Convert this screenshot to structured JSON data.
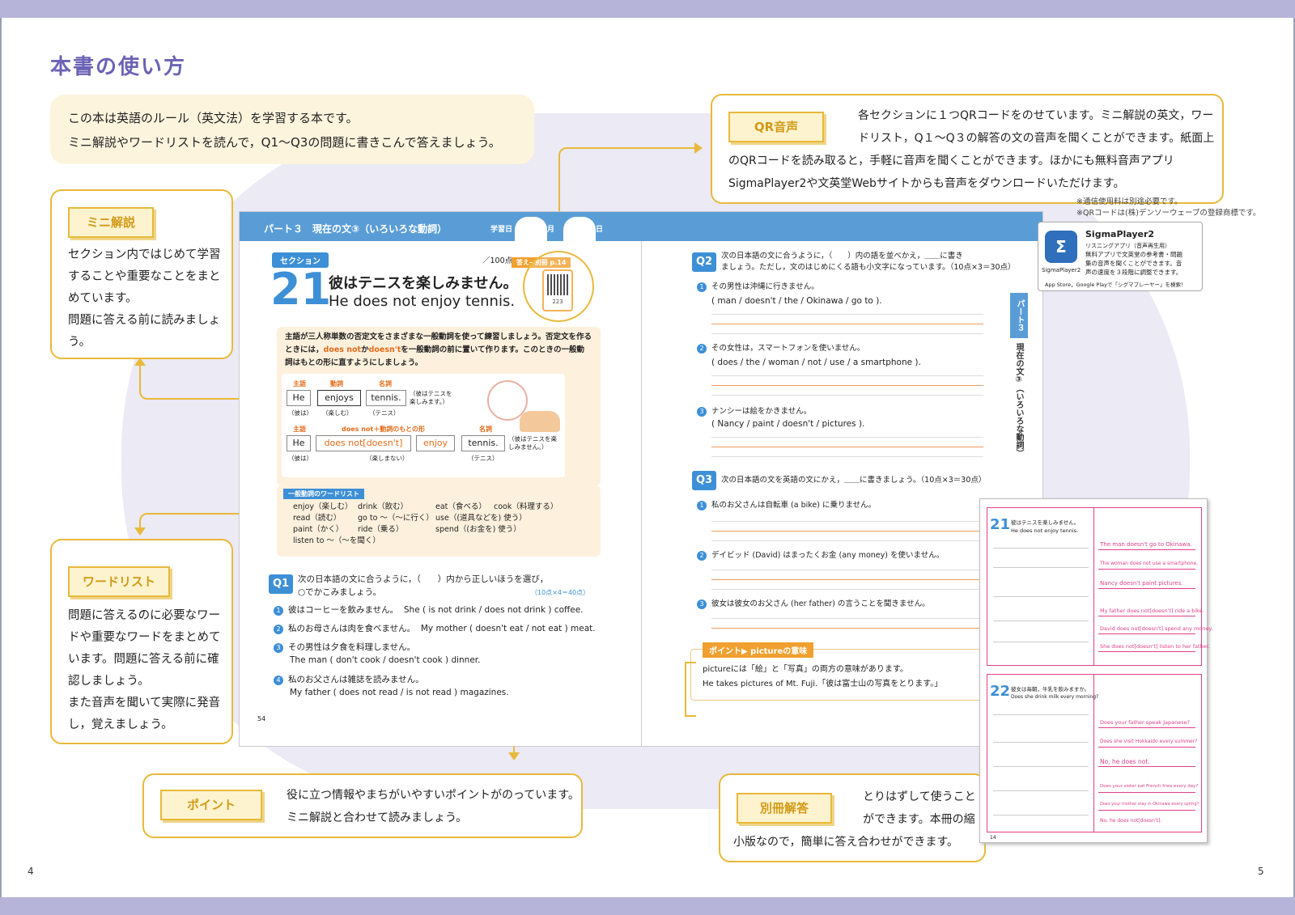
{
  "page_title": "本書の使い方",
  "intro": {
    "line1": "この本は英語のルール（英文法）を学習する本です。",
    "line2": "ミニ解説やワードリストを読んで，Q1～Q3の問題に書きこんで答えましょう。"
  },
  "mini": {
    "tag": "ミニ解説",
    "lines": [
      "セクション内ではじめて学習",
      "することや重要なことをまと",
      "めています。",
      "問題に答える前に読みましょ",
      "う。"
    ]
  },
  "wordlist": {
    "tag": "ワードリスト",
    "lines": [
      "問題に答えるのに必要なワー",
      "ドや重要なワードをまとめて",
      "います。問題に答える前に確",
      "認しましょう。",
      "また音声を聞いて実際に発音",
      "し，覚えましょう。"
    ]
  },
  "qr": {
    "tag": "QR音声",
    "lines": [
      "各セクションに１つQRコードをのせています。ミニ解説の英文，ワー",
      "ドリスト，Q１～Q３の解答の文の音声を聞くことができます。紙面上",
      "のQRコードを読み取ると，手軽に音声を聞くことができます。ほかにも無料音声アプリ",
      "SigmaPlayer2や文英堂Webサイトからも音声をダウンロードいただけます。"
    ],
    "note1": "※通信使用料は別途必要です。",
    "note2": "※QRコードは(株)デンソーウェーブの登録商標です。"
  },
  "sigma": {
    "name": "SigmaPlayer2",
    "sub": "リスニングアプリ（音声再生用）",
    "desc1": "無料アプリで文英堂の参考書・問題",
    "desc2": "集の音声を聞くことができます。音",
    "desc3": "声の速度を３段階に調整できます。",
    "icon_label": "SigmaPlayer2",
    "store": "App Store，Google Playで「シグマプレーヤー」を検索！"
  },
  "point": {
    "tag": "ポイント",
    "line1": "役に立つ情報やまちがいやすいポイントがのっています。",
    "line2": "ミニ解説と合わせて読みましょう。"
  },
  "answers": {
    "tag": "別冊解答",
    "line1": "とりはずして使うこと",
    "line2": "ができます。本冊の縮",
    "line3": "小版なので，簡単に答え合わせができます。"
  },
  "book": {
    "header": "パート３　現在の文③（いろいろな動詞）",
    "study_label": "学習日",
    "month": "月",
    "day": "日",
    "score": "／100点",
    "answer_ref": "答え→別冊 p.14",
    "section_label": "セクション",
    "section_num": "21",
    "title_jp": "彼はテニスを楽しみません。",
    "title_en": "He does not enjoy tennis.",
    "explain1": "主語が三人称単数の否定文をさまざまな一般動詞を使って練習しましょう。否定文を作る",
    "explain2a": "ときには，",
    "explain2b": "does not",
    "explain2c": "か",
    "explain2d": "doesn't",
    "explain2e": "を一般動詞の前に置いて作ります。このときの一般動",
    "explain3": "詞はもとの形に直すようにしましょう。",
    "ex1": {
      "subj_l": "主語",
      "verb_l": "動詞",
      "noun_l": "名詞",
      "w1": "He",
      "w2": "enjoys",
      "w3": "tennis.",
      "g1": "（彼は）",
      "g2": "（楽しむ）",
      "g3": "（テニス）",
      "tr": "（彼はテニスを楽しみます。）"
    },
    "ex2": {
      "subj_l": "主語",
      "verb_l": "does not＋動詞のもとの形",
      "noun_l": "名詞",
      "w1": "He",
      "w2": "does not[doesn't]",
      "w3": "enjoy",
      "w4": "tennis.",
      "g1": "（彼は）",
      "g2": "（楽しまない）",
      "g3": "（テニス）",
      "tr": "（彼はテニスを楽しみません。）"
    },
    "wl_title": "一般動詞のワードリスト",
    "wl": [
      "enjoy（楽しむ）",
      "drink（飲む）",
      "eat（食べる）",
      "cook（料理する）",
      "read（読む）",
      "go to ～（～に行く）",
      "use（(道具などを) 使う）",
      "paint（かく）",
      "ride（乗る）",
      "spend（(お金を) 使う）",
      "listen to ～（～を聞く）"
    ],
    "q1_badge": "Q1",
    "q1_inst1": "次の日本語の文に合うように，（　　）内から正しいほうを選び，",
    "q1_inst2": "○でかこみましょう。",
    "q1_pts": "（10点×4＝40点）",
    "q1": [
      {
        "n": "1",
        "jp": "彼はコーヒーを飲みません。",
        "en": "She ( is not drink / does not drink ) coffee."
      },
      {
        "n": "2",
        "jp": "私のお母さんは肉を食べません。",
        "en": "My mother ( doesn't eat / not eat ) meat."
      },
      {
        "n": "3",
        "jp": "その男性は夕食を料理しません。",
        "en": "The man ( don't cook / doesn't cook ) dinner."
      },
      {
        "n": "4",
        "jp": "私のお父さんは雑誌を読みません。",
        "en": "My father ( does not read / is not read ) magazines."
      }
    ],
    "page_left": "54",
    "q2_badge": "Q2",
    "q2_inst1": "次の日本語の文に合うように，（　　）内の語を並べかえ，＿＿に書き",
    "q2_inst2": "ましょう。ただし，文のはじめにくる語も小文字になっています。（10点×3＝30点）",
    "q2": [
      {
        "n": "1",
        "jp": "その男性は沖縄に行きません。",
        "en": "( man / doesn't / the / Okinawa / go to )."
      },
      {
        "n": "2",
        "jp": "その女性は，スマートフォンを使いません。",
        "en": "( does / the / woman / not / use / a smartphone )."
      },
      {
        "n": "3",
        "jp": "ナンシーは絵をかきません。",
        "en": "( Nancy / paint / doesn't / pictures )."
      }
    ],
    "q3_badge": "Q3",
    "q3_inst": "次の日本語の文を英語の文にかえ，＿＿に書きましょう。（10点×3＝30点）",
    "q3": [
      {
        "n": "1",
        "jp": "私のお父さんは自転車 (a bike) に乗りません。"
      },
      {
        "n": "2",
        "jp": "デイビッド (David) はまったくお金 (any money) を使いません。"
      },
      {
        "n": "3",
        "jp": "彼女は彼女のお父さん (her father) の言うことを聞きません。"
      }
    ],
    "side_tab": "パート３",
    "side_title": "現在の文③（いろいろな動詞）",
    "point_tag": "ポイント▶ pictureの意味",
    "point1": "pictureには「絵」と「写真」の両方の意味があります。",
    "point2": "He takes pictures of Mt. Fuji.「彼は富士山の写真をとります。」",
    "qr_num": "223"
  },
  "answer_page": {
    "sec21": "21",
    "sec22": "22",
    "t21": "彼はテニスを楽しみません。",
    "e21": "He does not enjoy tennis.",
    "t22": "彼女は毎朝，牛乳を飲みますか。",
    "e22": "Does she drink milk every morning?",
    "a1": "The man doesn't go to Okinawa.",
    "a2": "The woman does not use a smartphone.",
    "a3": "Nancy doesn't paint pictures.",
    "a4": "My father does not[doesn't] ride a bike.",
    "a5": "David does not[doesn't] spend any money.",
    "a6": "She does not[doesn't] listen to her father.",
    "a7": "Does your father speak Japanese?",
    "a8": "Does she visit Hokkaido every summer?",
    "a9": "No, he does not.",
    "a10": "Does your sister eat French fries every day?",
    "a11": "Does your mother stay in Okinawa every spring?",
    "a12": "No, he does not[doesn't].",
    "pn": "14"
  },
  "page_left_num": "4",
  "page_right_num": "5"
}
